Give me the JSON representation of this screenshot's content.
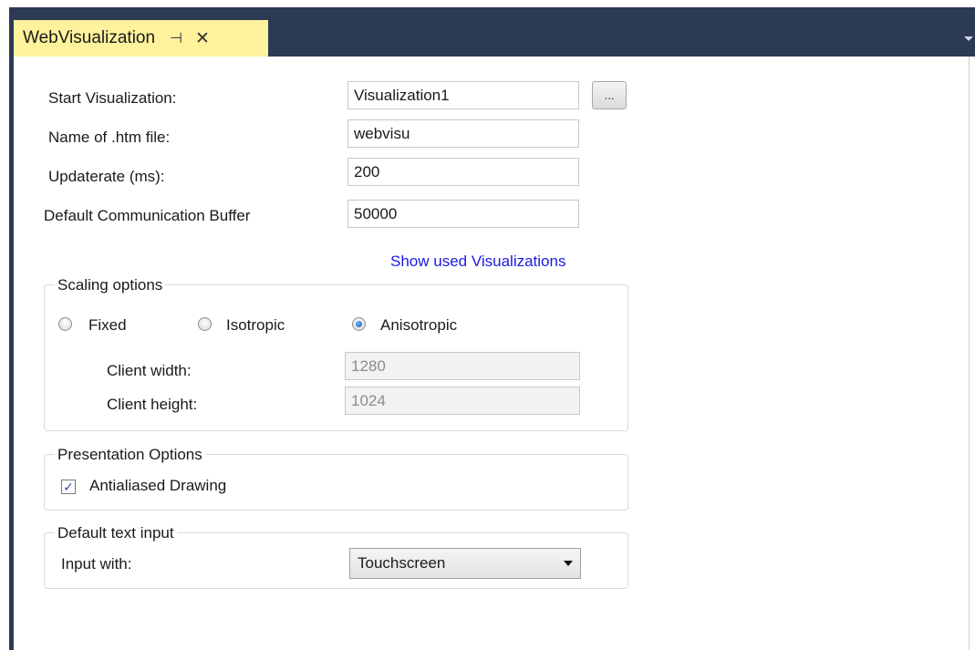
{
  "tab": {
    "title": "WebVisualization",
    "pin_glyph": "⊣",
    "close_glyph": "✕"
  },
  "form": {
    "start_visualization": {
      "label": "Start Visualization:",
      "value": "Visualization1",
      "browse_label": "..."
    },
    "htm_file": {
      "label": "Name of .htm file:",
      "value": "webvisu"
    },
    "update_rate": {
      "label": "Updaterate (ms):",
      "value": "200"
    },
    "comm_buffer": {
      "label": "Default Communication Buffer",
      "value": "50000"
    },
    "show_used_link": "Show used Visualizations"
  },
  "scaling": {
    "title": "Scaling options",
    "options": [
      "Fixed",
      "Isotropic",
      "Anisotropic"
    ],
    "selected": "Anisotropic",
    "client_width": {
      "label": "Client width:",
      "value": "1280"
    },
    "client_height": {
      "label": "Client height:",
      "value": "1024"
    }
  },
  "presentation": {
    "title": "Presentation Options",
    "antialiased": {
      "label": "Antialiased Drawing",
      "checked": true
    }
  },
  "text_input": {
    "title": "Default text input",
    "label": "Input with:",
    "value": "Touchscreen"
  }
}
